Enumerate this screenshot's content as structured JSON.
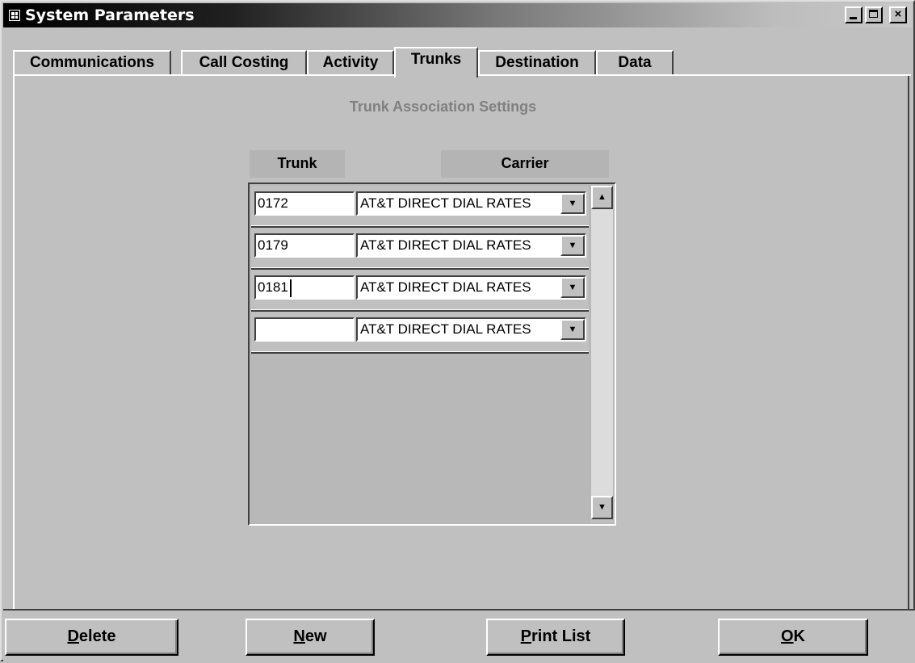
{
  "window": {
    "title": "System Parameters",
    "controls": [
      "minimize-icon",
      "maximize-icon",
      "close-icon"
    ],
    "close_glyph": "×"
  },
  "tabs": [
    {
      "label": "Communications",
      "active": false
    },
    {
      "label": "Call Costing",
      "active": false
    },
    {
      "label": "Activity",
      "active": false
    },
    {
      "label": "Trunks",
      "active": true
    },
    {
      "label": "Destination",
      "active": false
    },
    {
      "label": "Data",
      "active": false
    }
  ],
  "section": {
    "title": "Trunk Association Settings",
    "columns": {
      "trunk": "Trunk",
      "carrier": "Carrier"
    }
  },
  "rows": [
    {
      "trunk": "0172",
      "carrier": "AT&T DIRECT DIAL RATES"
    },
    {
      "trunk": "0179",
      "carrier": "AT&T DIRECT DIAL RATES"
    },
    {
      "trunk": "0181",
      "carrier": "AT&T DIRECT DIAL RATES",
      "focused": true
    },
    {
      "trunk": "",
      "carrier": "AT&T DIRECT DIAL RATES"
    }
  ],
  "buttons": {
    "delete": {
      "accel": "D",
      "rest": "elete"
    },
    "new": {
      "accel": "N",
      "rest": "ew"
    },
    "print": {
      "accel": "P",
      "rest": "rint List"
    },
    "ok": {
      "accel": "O",
      "rest": "K"
    }
  },
  "glyphs": {
    "dropdown": "▼",
    "scroll_up": "▲",
    "scroll_down": "▼"
  }
}
